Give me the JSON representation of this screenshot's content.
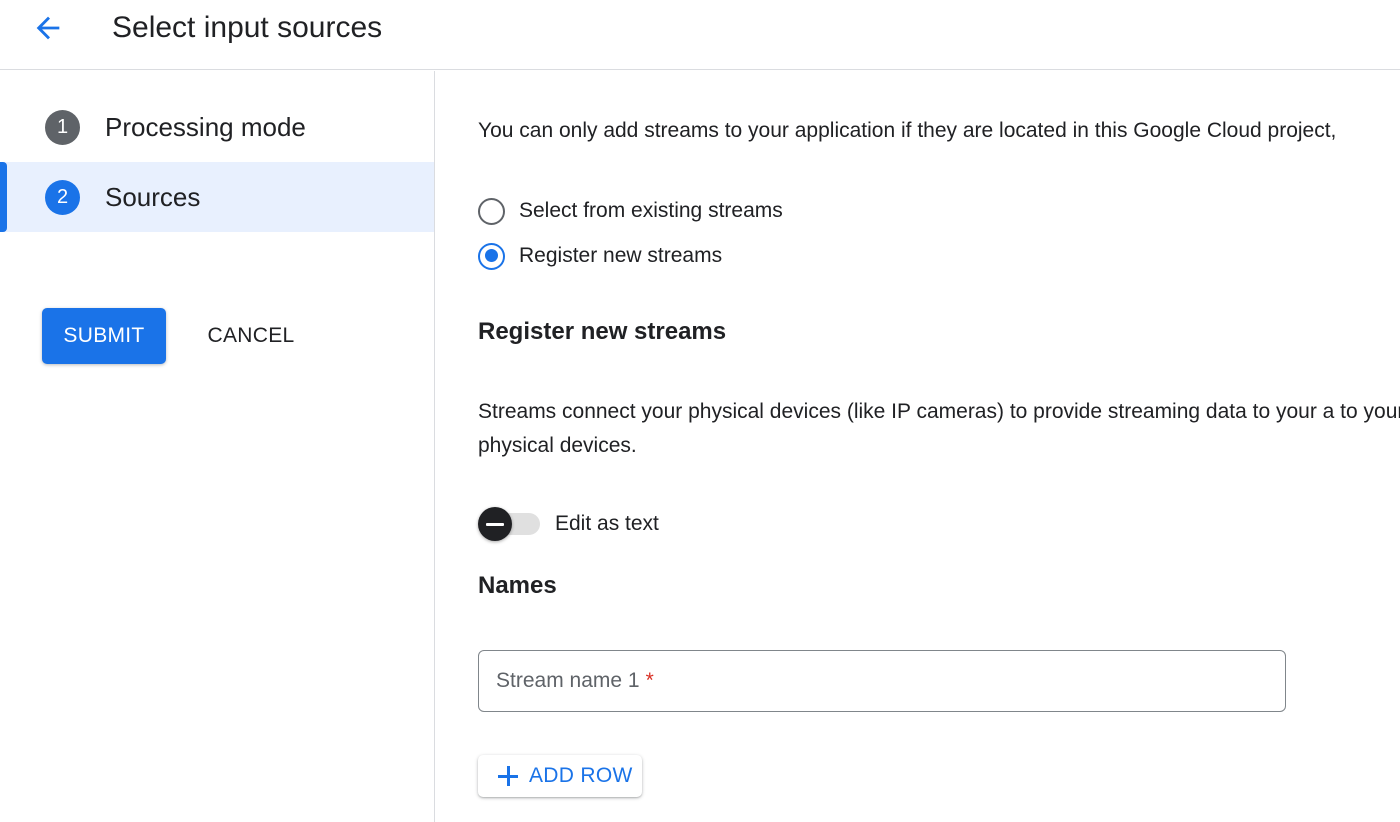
{
  "header": {
    "back_icon": "arrow-back-icon",
    "title": "Select input sources"
  },
  "stepper": {
    "steps": [
      {
        "number": "1",
        "label": "Processing mode",
        "state": "completed"
      },
      {
        "number": "2",
        "label": "Sources",
        "state": "active"
      }
    ]
  },
  "actions": {
    "submit_label": "SUBMIT",
    "cancel_label": "CANCEL"
  },
  "main": {
    "intro": "You can only add streams to your application if they are located in this Google Cloud project,",
    "radio_options": [
      {
        "label": "Select from existing streams",
        "checked": false
      },
      {
        "label": "Register new streams",
        "checked": true
      }
    ],
    "section_heading": "Register new streams",
    "description": "Streams connect your physical devices (like IP cameras) to provide streaming data to your a to your physical devices.",
    "toggle": {
      "label": "Edit as text",
      "on": false
    },
    "names_heading": "Names",
    "stream_input": {
      "label": "Stream name 1",
      "required_mark": "*",
      "value": ""
    },
    "add_row_label": "ADD ROW",
    "add_row_icon": "plus-icon"
  },
  "colors": {
    "accent": "#1a73e8",
    "active_step_bg": "#e8f0fe",
    "required": "#d93025"
  }
}
